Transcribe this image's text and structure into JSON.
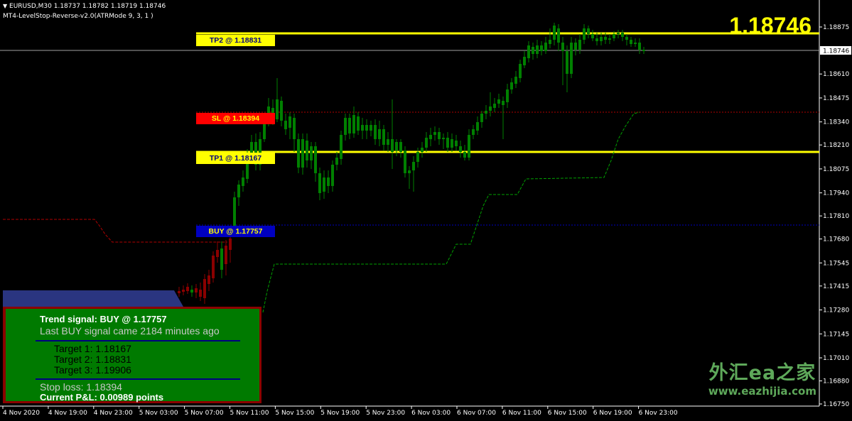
{
  "header": {
    "symbol_line": "EURUSD,M30  1.18737 1.18782 1.18719 1.18746",
    "indicator_line": "MT4-LevelStop-Reverse-v2.0(ATRMode 9, 3, 1 )"
  },
  "current_price": "1.18746",
  "price_axis": {
    "min": 1.1675,
    "max": 1.1887,
    "ticks": [
      "1.18875",
      "1.18610",
      "1.18475",
      "1.18340",
      "1.18210",
      "1.18075",
      "1.17940",
      "1.17810",
      "1.17680",
      "1.17545",
      "1.17415",
      "1.17280",
      "1.17145",
      "1.17010",
      "1.16880",
      "1.16750"
    ],
    "current_label": "1.18746"
  },
  "time_axis": {
    "labels": [
      "4 Nov 2020",
      "4 Nov 19:00",
      "4 Nov 23:00",
      "5 Nov 03:00",
      "5 Nov 07:00",
      "5 Nov 11:00",
      "5 Nov 15:00",
      "5 Nov 19:00",
      "5 Nov 23:00",
      "6 Nov 03:00",
      "6 Nov 07:00",
      "6 Nov 11:00",
      "6 Nov 15:00",
      "6 Nov 19:00",
      "6 Nov 23:00"
    ]
  },
  "levels": {
    "tp2": {
      "label": "TP2 @ 1.18831",
      "price": 1.18831,
      "bg": "#ffff00",
      "fg": "#000080"
    },
    "sl": {
      "label": "SL @ 1.18394",
      "price": 1.18394,
      "bg": "#ff0000",
      "fg": "#ffff00"
    },
    "tp1": {
      "label": "TP1 @ 1.18167",
      "price": 1.18167,
      "bg": "#ffff00",
      "fg": "#000080"
    },
    "buy": {
      "label": "BUY @ 1.17757",
      "price": 1.17757,
      "bg": "#0000c0",
      "fg": "#ffff00"
    }
  },
  "colors": {
    "bull": "#008000",
    "bear": "#8b0000",
    "level_yellow": "#ffff00",
    "sl_line": "#b00000",
    "buy_line": "#0000c0",
    "stop_green": "#00a000",
    "stop_red": "#b00000"
  },
  "panel": {
    "trend_signal": "Trend signal: BUY @ 1.17757",
    "last_signal": "Last BUY signal came 2184 minutes ago",
    "target1": "Target 1: 1.18167",
    "target2": "Target 2: 1.18831",
    "target3": "Target 3: 1.19906",
    "stop_loss": "Stop loss: 1.18394",
    "pnl": "Current P&L: 0.00989 points"
  },
  "watermark": {
    "line1": "外汇ea之家",
    "line2": "www.eazhijia.com"
  }
}
